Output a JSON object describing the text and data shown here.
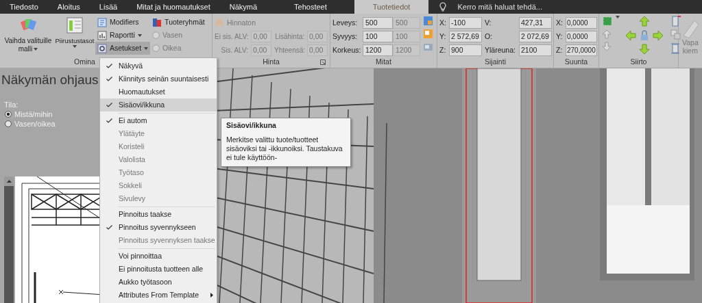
{
  "tabs": [
    {
      "label": "Tiedosto",
      "selected": false
    },
    {
      "label": "Aloitus",
      "selected": false
    },
    {
      "label": "Lisää",
      "selected": false
    },
    {
      "label": "Mitat ja huomautukset",
      "selected": false
    },
    {
      "label": "Näkymä",
      "selected": false
    },
    {
      "label": "Tehosteet",
      "selected": false
    },
    {
      "label": "Tuotetiedot",
      "selected": true
    }
  ],
  "tell_me": {
    "placeholder": "Kerro mitä haluat tehdä..."
  },
  "ribbon": {
    "properties": {
      "label": "Omina",
      "large_buttons": [
        {
          "label": "Vaihda valituille malli",
          "dropdown": true
        },
        {
          "label": "Piirustustasot",
          "dropdown": true
        }
      ],
      "small_buttons": [
        {
          "label": "Modifiers",
          "dropdown": false,
          "pressed": false
        },
        {
          "label": "Raportti",
          "dropdown": true,
          "pressed": false
        },
        {
          "label": "Asetukset",
          "dropdown": true,
          "pressed": true
        }
      ],
      "groups_button": {
        "label": "Tuoteryhmät"
      },
      "sides": [
        {
          "label": "Vasen",
          "selected": false,
          "disabled": true
        },
        {
          "label": "Oikea",
          "selected": false,
          "disabled": true
        }
      ]
    },
    "price": {
      "label": "Hinta",
      "no_price": {
        "label": "Hinnaton",
        "disabled": true
      },
      "fields": [
        {
          "label": "Ei sis. ALV:",
          "value": "0,00",
          "disabled": true
        },
        {
          "label": "Lisähinta:",
          "value": "0,00",
          "disabled": true
        },
        {
          "label": "Sis. ALV:",
          "value": "0,00",
          "disabled": true
        },
        {
          "label": "Yhteensä:",
          "value": "0,00",
          "disabled": true
        }
      ]
    },
    "dimensions": {
      "label": "Mitat",
      "rows": [
        {
          "label": "Leveys:",
          "value": "500",
          "original": "500"
        },
        {
          "label": "Syvyys:",
          "value": "100",
          "original": "100"
        },
        {
          "label": "Korkeus:",
          "value": "1200",
          "original": "1200"
        }
      ]
    },
    "position": {
      "label": "Sijainti",
      "fields": [
        {
          "label": "X:",
          "value": "-100"
        },
        {
          "label": "V:",
          "value": "427,31"
        },
        {
          "label": "Y:",
          "value": "2 572,69"
        },
        {
          "label": "O:",
          "value": "2 072,69"
        },
        {
          "label": "Z:",
          "value": "900"
        },
        {
          "label": "Yläreuna:",
          "value": "2100"
        }
      ]
    },
    "orientation": {
      "label": "Suunta",
      "fields": [
        {
          "label": "X:",
          "value": "0,0000"
        },
        {
          "label": "Y:",
          "value": "0,0000"
        },
        {
          "label": "Z:",
          "value": "270,0000"
        }
      ]
    },
    "move": {
      "label": "Siirto"
    },
    "free_button": {
      "lines": [
        "Vapa",
        "kiem"
      ],
      "disabled": true
    }
  },
  "menu": {
    "items": [
      {
        "kind": "item",
        "label": "Näkyvä",
        "checked": true,
        "disabled": false,
        "highlighted": false,
        "submenu": false
      },
      {
        "kind": "item",
        "label": "Kiinnitys seinän suuntaisesti",
        "checked": true,
        "disabled": false,
        "highlighted": false,
        "submenu": false
      },
      {
        "kind": "item",
        "label": "Huomautukset",
        "checked": false,
        "disabled": false,
        "highlighted": false,
        "submenu": false
      },
      {
        "kind": "item",
        "label": "Sisäovi/ikkuna",
        "checked": true,
        "disabled": false,
        "highlighted": true,
        "submenu": false
      },
      {
        "kind": "separator"
      },
      {
        "kind": "item",
        "label": "Ei autom",
        "checked": true,
        "disabled": false,
        "highlighted": false,
        "submenu": false
      },
      {
        "kind": "item",
        "label": "Ylätäyte",
        "checked": false,
        "disabled": true,
        "highlighted": false,
        "submenu": false
      },
      {
        "kind": "item",
        "label": "Koristeli",
        "checked": false,
        "disabled": true,
        "highlighted": false,
        "submenu": false
      },
      {
        "kind": "item",
        "label": "Valolista",
        "checked": false,
        "disabled": true,
        "highlighted": false,
        "submenu": false
      },
      {
        "kind": "item",
        "label": "Työtaso",
        "checked": false,
        "disabled": true,
        "highlighted": false,
        "submenu": false
      },
      {
        "kind": "item",
        "label": "Sokkeli",
        "checked": false,
        "disabled": true,
        "highlighted": false,
        "submenu": false
      },
      {
        "kind": "item",
        "label": "Sivulevy",
        "checked": false,
        "disabled": true,
        "highlighted": false,
        "submenu": false
      },
      {
        "kind": "separator"
      },
      {
        "kind": "item",
        "label": "Pinnoitus taakse",
        "checked": false,
        "disabled": false,
        "highlighted": false,
        "submenu": false
      },
      {
        "kind": "item",
        "label": "Pinnoitus syvennykseen",
        "checked": true,
        "disabled": false,
        "highlighted": false,
        "submenu": false
      },
      {
        "kind": "item",
        "label": "Pinnoitus syvennyksen taakse",
        "checked": false,
        "disabled": true,
        "highlighted": false,
        "submenu": false
      },
      {
        "kind": "separator"
      },
      {
        "kind": "item",
        "label": "Voi pinnoittaa",
        "checked": false,
        "disabled": false,
        "highlighted": false,
        "submenu": false
      },
      {
        "kind": "item",
        "label": "Ei pinnoitusta tuotteen alle",
        "checked": false,
        "disabled": false,
        "highlighted": false,
        "submenu": false
      },
      {
        "kind": "item",
        "label": "Aukko työtasoon",
        "checked": false,
        "disabled": false,
        "highlighted": false,
        "submenu": false
      },
      {
        "kind": "item",
        "label": "Attributes From Template",
        "checked": false,
        "disabled": false,
        "highlighted": false,
        "submenu": true
      }
    ]
  },
  "tooltip": {
    "title": "Sisäovi/ikkuna",
    "text": "Merkitse valittu tuote/tuotteet sisäoviksi tai -ikkunoiksi. Taustakuva ei tule käyttöön-"
  },
  "view_panel": {
    "title": "Näkymän ohjaus",
    "mode_label": "Tila:",
    "modes": [
      {
        "label": "Mistä/mihin",
        "selected": true
      },
      {
        "label": "Vasen/oikea",
        "selected": false
      }
    ]
  }
}
